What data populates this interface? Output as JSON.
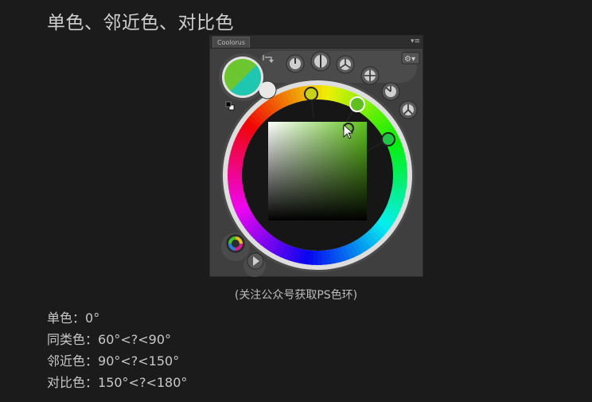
{
  "page": {
    "title": "单色、邻近色、对比色",
    "caption": "(关注公众号获取PS色环)"
  },
  "panel": {
    "tab_label": "Coolorus",
    "menu_icon": "panel-menu-icon"
  },
  "colors": {
    "background": "#1b1b1b",
    "panel": "#3f3f3f",
    "primary_swatch": "#6cc62f",
    "secondary_swatch": "#1fc6b0",
    "selected_hue": "#66b21a"
  },
  "icons": [
    "swap-colors-icon",
    "default-colors-icon",
    "harmony-mono-icon",
    "harmony-complementary-icon",
    "harmony-triad-icon",
    "harmony-quad-icon",
    "harmony-analogous-icon",
    "harmony-split-icon",
    "settings-gear-icon",
    "mini-wheel-icon",
    "play-icon"
  ],
  "notes": [
    {
      "label": "单色：",
      "value": "0°"
    },
    {
      "label": "同类色：",
      "value": "60°<?<90°"
    },
    {
      "label": "邻近色：",
      "value": "90°<?<150°"
    },
    {
      "label": "对比色：",
      "value": "150°<?<180°"
    }
  ]
}
